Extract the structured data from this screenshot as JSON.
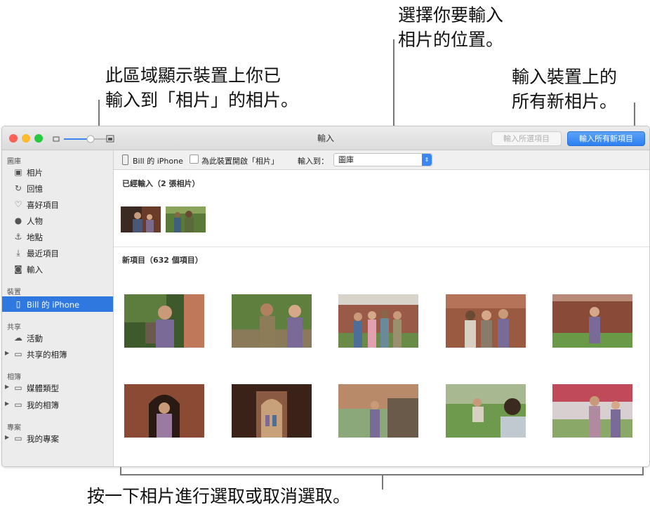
{
  "callouts": {
    "import_location": [
      "選擇你要輸入",
      "相片的位置。"
    ],
    "already_imported": [
      "此區域顯示裝置上你已",
      "輸入到「相片」的相片。"
    ],
    "import_all": [
      "輸入裝置上的",
      "所有新相片。"
    ],
    "click_select": "按一下相片進行選取或取消選取。"
  },
  "window": {
    "title": "輸入",
    "import_selected_label": "輸入所選項目",
    "import_all_label": "輸入所有新項目"
  },
  "sidebar": {
    "library_header": "圖庫",
    "library_items": [
      {
        "label": "相片",
        "icon": "photos-icon"
      },
      {
        "label": "回憶",
        "icon": "memories-icon"
      },
      {
        "label": "喜好項目",
        "icon": "heart-icon"
      },
      {
        "label": "人物",
        "icon": "person-icon"
      },
      {
        "label": "地點",
        "icon": "pin-icon"
      },
      {
        "label": "最近項目",
        "icon": "recent-icon"
      },
      {
        "label": "輸入",
        "icon": "camera-icon"
      }
    ],
    "devices_header": "裝置",
    "device_item": "Bill 的 iPhone",
    "shared_header": "共享",
    "shared_items": [
      "活動",
      "共享的相簿"
    ],
    "albums_header": "相簿",
    "album_items": [
      "媒體類型",
      "我的相簿"
    ],
    "projects_header": "專案",
    "project_items": [
      "我的專案"
    ]
  },
  "toolbar": {
    "device_name": "Bill 的 iPhone",
    "open_photos_checkbox_label": "為此裝置開啟「相片」",
    "open_photos_checked": false,
    "import_to_label": "輸入到：",
    "import_to_value": "圖庫"
  },
  "content": {
    "already_imported_title": "已經輸入（2 張相片）",
    "new_items_title": "新項目（632 個項目）"
  },
  "colors": {
    "accent": "#2f78e0",
    "traffic_red": "#fc5f57",
    "traffic_yellow": "#fdbc2e",
    "traffic_green": "#28c840"
  }
}
